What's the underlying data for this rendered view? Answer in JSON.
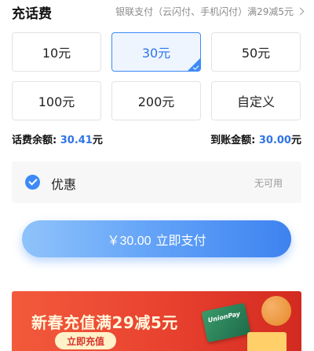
{
  "header": {
    "title": "充话费",
    "promo_text": "银联支付（云闪付、手机闪付）满29减5元"
  },
  "amounts": [
    {
      "label": "10元",
      "selected": false
    },
    {
      "label": "30元",
      "selected": true
    },
    {
      "label": "50元",
      "selected": false
    },
    {
      "label": "100元",
      "selected": false
    },
    {
      "label": "200元",
      "selected": false
    },
    {
      "label": "自定义",
      "selected": false
    }
  ],
  "balance": {
    "label": "话费余额: ",
    "value": "30.41",
    "unit": "元"
  },
  "arrival": {
    "label": "到账金额: ",
    "value": "30.00",
    "unit": "元"
  },
  "discount": {
    "label": "优惠",
    "status": "无可用"
  },
  "pay_button": {
    "amount": "￥30.00",
    "label": "立即支付"
  },
  "banner": {
    "title": "新春充值满29减5元",
    "button_label": "立即充值",
    "card_text": "UnionPay"
  },
  "colors": {
    "accent": "#3d8af7",
    "banner_red": "#e8412f"
  }
}
